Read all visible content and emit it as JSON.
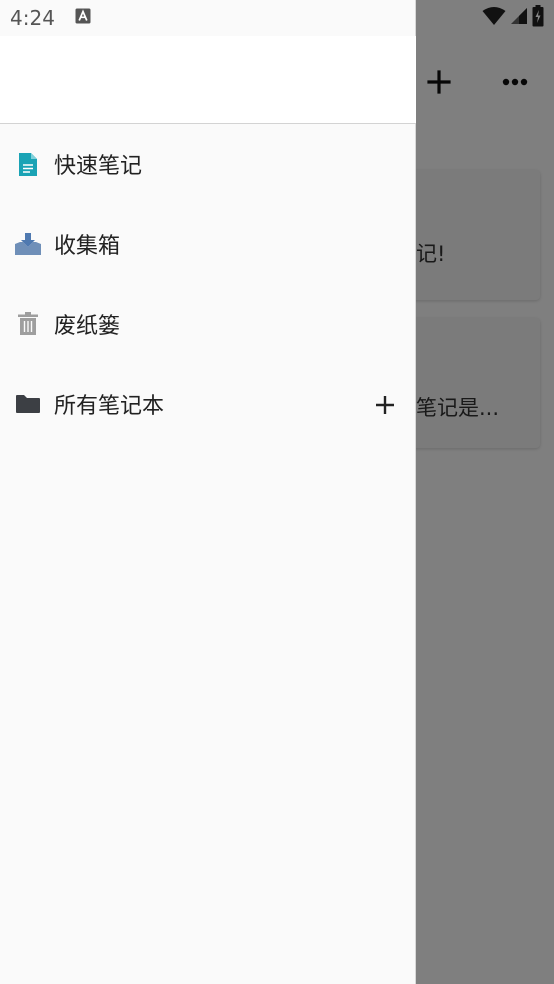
{
  "status_bar": {
    "time": "4:24",
    "keyboard_indicator": "A"
  },
  "background_page": {
    "card_1_text": "记!",
    "card_2_text": "笔记是..."
  },
  "drawer": {
    "items": [
      {
        "label": "快速笔记",
        "icon": "document-icon",
        "color": "#1aa3b5"
      },
      {
        "label": "收集箱",
        "icon": "inbox-download-icon",
        "color": "#6f8fb8"
      },
      {
        "label": "废纸篓",
        "icon": "trash-icon",
        "color": "#9e9e9e"
      },
      {
        "label": "所有笔记本",
        "icon": "folder-icon",
        "color": "#3c3f44"
      }
    ]
  },
  "colors": {
    "drawer_bg": "#fafafa",
    "scrim": "rgba(0,0,0,0.5)",
    "text_primary": "#222222"
  }
}
